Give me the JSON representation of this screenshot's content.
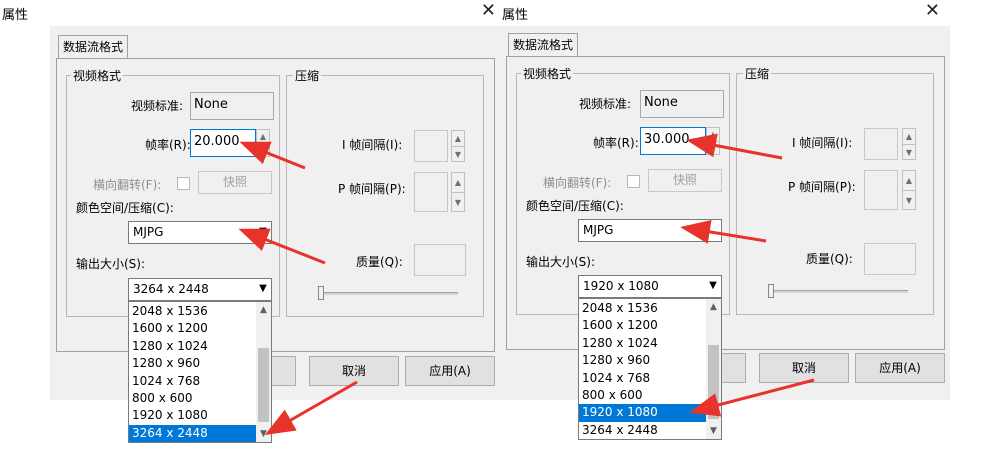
{
  "colors": {
    "arrow": "#e8322c",
    "selection": "#0078d7",
    "dialog_bg": "#f0f0f0"
  },
  "left": {
    "title": "属性",
    "tab": "数据流格式",
    "video_group": "视频格式",
    "compress_group": "压缩",
    "video_standard_label": "视频标准:",
    "video_standard_value": "None",
    "frame_rate_label": "帧率(R):",
    "frame_rate_value": "20.000",
    "flip_label": "横向翻转(F):",
    "snapshot_label": "快照",
    "color_space_label": "颜色空间/压缩(C):",
    "color_space_value": "MJPG",
    "output_size_label": "输出大小(S):",
    "output_size_value": "3264 x 2448",
    "i_frame_label": "I 帧间隔(I):",
    "p_frame_label": "P 帧间隔(P):",
    "quality_label": "质量(Q):",
    "cancel_label": "取消",
    "apply_label": "应用(A)",
    "size_options": [
      "2048 x 1536",
      "1600 x 1200",
      "1280 x 1024",
      "1280 x 960",
      "1024 x 768",
      "800 x 600",
      "1920 x 1080",
      "3264 x 2448"
    ],
    "selected_index": 7
  },
  "right": {
    "title": "属性",
    "tab": "数据流格式",
    "video_group": "视频格式",
    "compress_group": "压缩",
    "video_standard_label": "视频标准:",
    "video_standard_value": "None",
    "frame_rate_label": "帧率(R):",
    "frame_rate_value": "30.000",
    "flip_label": "横向翻转(F):",
    "snapshot_label": "快照",
    "color_space_label": "颜色空间/压缩(C):",
    "color_space_value": "MJPG",
    "output_size_label": "输出大小(S):",
    "output_size_value": "1920 x 1080",
    "i_frame_label": "I 帧间隔(I):",
    "p_frame_label": "P 帧间隔(P):",
    "quality_label": "质量(Q):",
    "cancel_label": "取消",
    "apply_label": "应用(A)",
    "size_options": [
      "2048 x 1536",
      "1600 x 1200",
      "1280 x 1024",
      "1280 x 960",
      "1024 x 768",
      "800 x 600",
      "1920 x 1080",
      "3264 x 2448"
    ],
    "selected_index": 6
  }
}
